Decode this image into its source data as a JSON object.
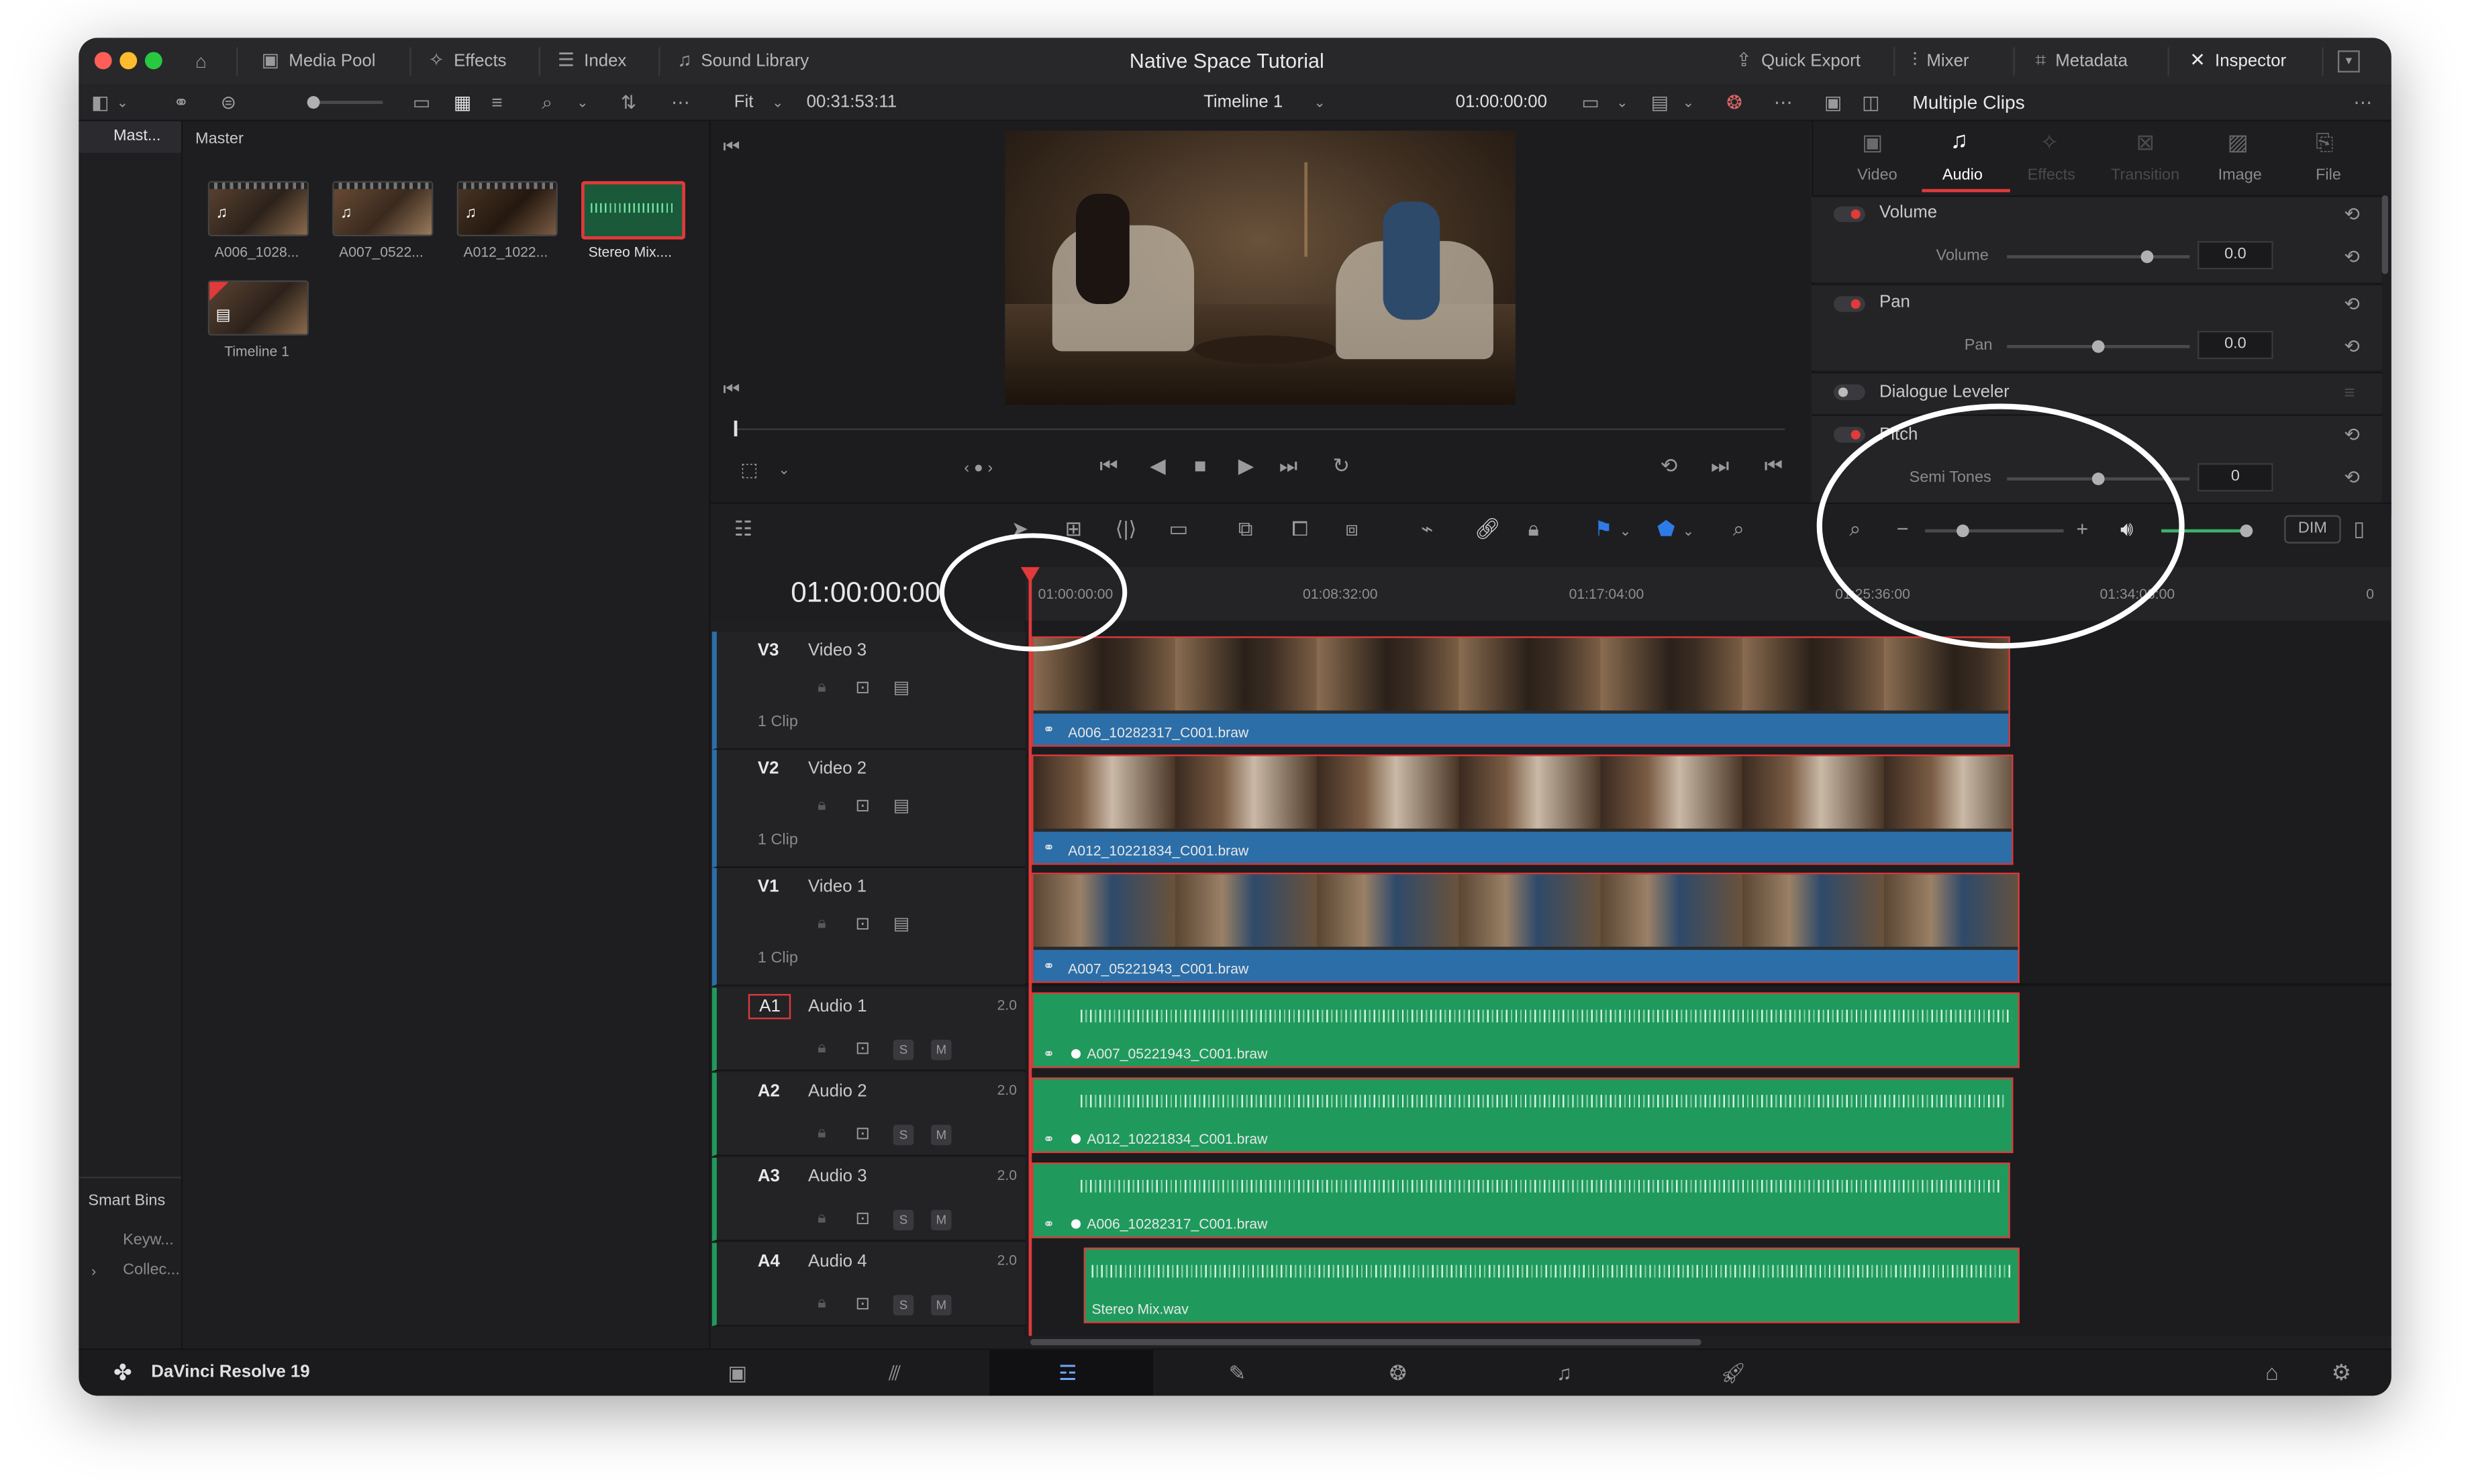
{
  "titlebar": {
    "project_title": "Native Space Tutorial",
    "media_pool": "Media Pool",
    "effects": "Effects",
    "index": "Index",
    "sound_library": "Sound Library",
    "quick_export": "Quick Export",
    "mixer": "Mixer",
    "metadata": "Metadata",
    "inspector": "Inspector"
  },
  "viewer_bar": {
    "fit": "Fit",
    "source_timecode": "00:31:53:11",
    "timeline_name": "Timeline 1",
    "record_timecode": "01:00:00:00"
  },
  "media_pool": {
    "bin_master_short": "Mast...",
    "bin_master": "Master",
    "clips": [
      {
        "label": "A006_1028..."
      },
      {
        "label": "A007_0522..."
      },
      {
        "label": "A012_1022..."
      },
      {
        "label": "Stereo Mix...."
      },
      {
        "label": "Timeline 1"
      }
    ],
    "smart_bins": "Smart Bins",
    "smart_items": [
      "Keyw...",
      "Collec..."
    ]
  },
  "inspector": {
    "header": "Multiple Clips",
    "tabs": [
      "Video",
      "Audio",
      "Effects",
      "Transition",
      "Image",
      "File"
    ],
    "volume_section": "Volume",
    "volume_label": "Volume",
    "volume_value": "0.0",
    "pan_section": "Pan",
    "pan_label": "Pan",
    "pan_value": "0.0",
    "dialogue_leveler": "Dialogue Leveler",
    "pitch_section": "Pitch",
    "semitones_label": "Semi Tones",
    "semitones_value": "0"
  },
  "timeline": {
    "current_timecode": "01:00:00:00",
    "ruler_ticks": [
      "01:00:00:00",
      "01:08:32:00",
      "01:17:04:00",
      "01:25:36:00",
      "01:34:08:00",
      "0"
    ],
    "dim_label": "DIM",
    "tracks": [
      {
        "id": "V3",
        "name": "Video 3",
        "count": "1 Clip",
        "clip": "A006_10282317_C001.braw"
      },
      {
        "id": "V2",
        "name": "Video 2",
        "count": "1 Clip",
        "clip": "A012_10221834_C001.braw"
      },
      {
        "id": "V1",
        "name": "Video 1",
        "count": "1 Clip",
        "clip": "A007_05221943_C001.braw"
      },
      {
        "id": "A1",
        "name": "Audio 1",
        "channels": "2.0",
        "clip": "A007_05221943_C001.braw"
      },
      {
        "id": "A2",
        "name": "Audio 2",
        "channels": "2.0",
        "clip": "A012_10221834_C001.braw"
      },
      {
        "id": "A3",
        "name": "Audio 3",
        "channels": "2.0",
        "clip": "A006_10282317_C001.braw"
      },
      {
        "id": "A4",
        "name": "Audio 4",
        "channels": "2.0",
        "clip": "Stereo Mix.wav"
      }
    ],
    "solo": "S",
    "mute": "M"
  },
  "footer": {
    "app_name": "DaVinci Resolve 19"
  },
  "colors": {
    "playhead": "#e03a3a",
    "video_clip": "#2c6ea8",
    "audio_clip": "#1f9a5c",
    "accent_red": "#e03a3a"
  }
}
